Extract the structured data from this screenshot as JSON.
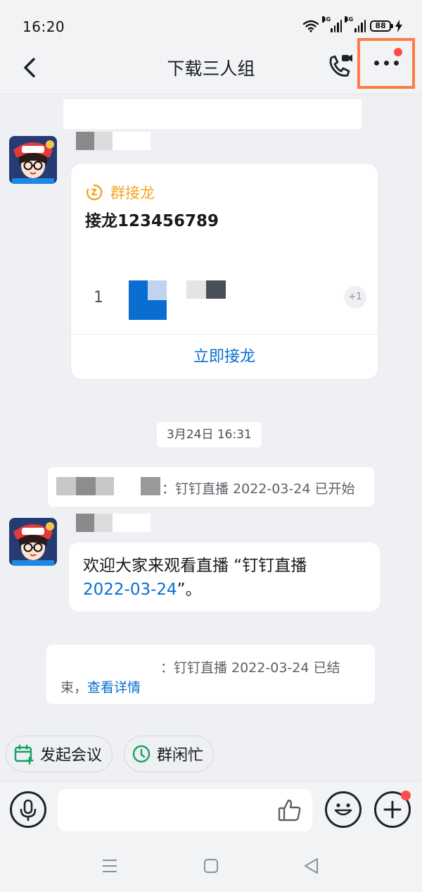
{
  "status_bar": {
    "time": "16:20",
    "network_1": "4G",
    "network_2": "4G",
    "battery": "88"
  },
  "header": {
    "title": "下载三人组",
    "back_icon": "chevron-left-icon",
    "call_icon": "phone-video-icon",
    "more_icon": "more-horizontal-icon"
  },
  "card": {
    "tag_label": "群接龙",
    "title": "接龙123456789",
    "row_number": "1",
    "row_badge": "+1",
    "action_label": "立即接龙"
  },
  "timestamp": "3月24日 16:31",
  "system_message_1": "：钉钉直播 2022-03-24 已开始",
  "bubble": {
    "text_before": "欢迎大家来观看直播 “钉钉直播",
    "link": "2022-03-24",
    "text_after": "”。"
  },
  "system_message_2": {
    "line1": "：钉钉直播 2022-03-24 已结",
    "line2_prefix": "束，",
    "link": "查看详情"
  },
  "quick_actions": [
    {
      "label": "发起会议",
      "icon": "calendar-plus-icon"
    },
    {
      "label": "群闲忙",
      "icon": "clock-icon"
    }
  ],
  "input_bar": {
    "voice_icon": "microphone-icon",
    "like_icon": "thumbs-up-icon",
    "emoji_icon": "smile-icon",
    "plus_icon": "plus-icon"
  },
  "colors": {
    "accent_blue": "#0a6ed1",
    "highlight_orange": "#ff7a45",
    "tag_orange": "#f5a623",
    "badge_red": "#ff4d4f"
  }
}
